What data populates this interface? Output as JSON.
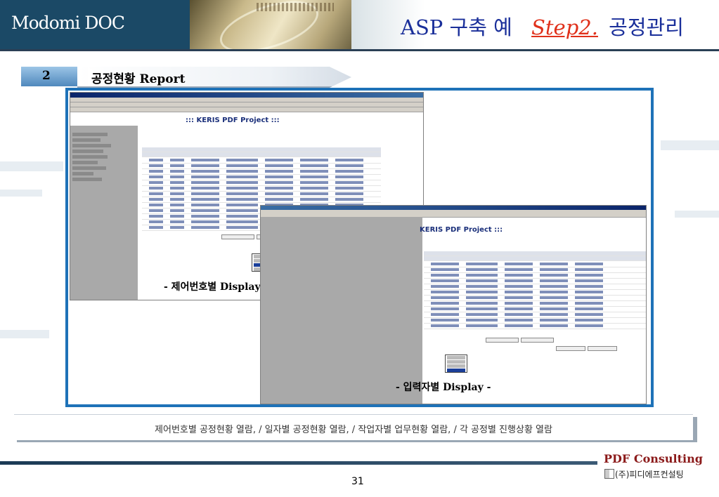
{
  "header": {
    "brand": "Modomi DOC",
    "title_prefix": "ASP 구축 예",
    "title_step": "Step2.",
    "title_suffix": "공정관리"
  },
  "section": {
    "number": "2",
    "title": "공정현황 Report"
  },
  "screenshots": [
    {
      "page_title": "::: KERIS PDF Project :::",
      "caption": "- 제어번호별 Display -"
    },
    {
      "page_title": "KERIS PDF Project :::",
      "caption": "- 입력자별 Display -"
    }
  ],
  "summary": "제어번호별 공정현황 열람, / 일자별 공정현황 열람, / 작업자별 업무현황 열람, / 각 공정별 진행상황 열람",
  "footer": {
    "page_number": "31",
    "company_name": "PDF Consulting",
    "company_sub": "(주)피디에프컨설팅"
  },
  "colors": {
    "header_bg": "#1b4966",
    "frame": "#1e72b8",
    "title_blue": "#1a2f9a",
    "step_red": "#e0301a",
    "company_red": "#8b1a1a"
  }
}
